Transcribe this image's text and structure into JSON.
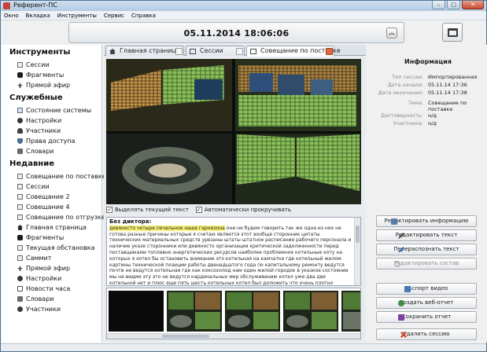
{
  "window": {
    "title": "Референт-ПС"
  },
  "menu": [
    "Окно",
    "Вкладка",
    "Инструменты",
    "Сервис",
    "Справка"
  ],
  "header": {
    "datetime": "05.11.2014  18:06:06",
    "collapse_icon": "double-chevron-up-icon",
    "screen_icon": "window-layout-icon"
  },
  "sidebar": {
    "tools_title": "Инструменты",
    "tools": [
      {
        "label": "Сессии",
        "icon": "session-icon"
      },
      {
        "label": "Фрагменты",
        "icon": "fragment-icon"
      },
      {
        "label": "Прямой эфир",
        "icon": "airplane-icon"
      }
    ],
    "service_title": "Служебные",
    "service": [
      {
        "label": "Состояние системы",
        "icon": "monitor-icon"
      },
      {
        "label": "Настройки",
        "icon": "gear-icon"
      },
      {
        "label": "Участники",
        "icon": "person-icon"
      },
      {
        "label": "Права доступа",
        "icon": "shield-icon"
      },
      {
        "label": "Словари",
        "icon": "book-icon"
      }
    ],
    "recent_title": "Недавние",
    "recent": [
      {
        "label": "Совещание по поставке",
        "icon": "session-icon"
      },
      {
        "label": "Сессии",
        "icon": "session-icon"
      },
      {
        "label": "Совещание 2",
        "icon": "session-icon"
      },
      {
        "label": "Совещание 4",
        "icon": "session-icon"
      },
      {
        "label": "Совещание по отгрузке",
        "icon": "session-icon"
      },
      {
        "label": "Главная страница",
        "icon": "home-icon"
      },
      {
        "label": "Фрагменты",
        "icon": "fragment-icon"
      },
      {
        "label": "Текущая обстановка",
        "icon": "session-icon"
      },
      {
        "label": "Саммит",
        "icon": "session-icon"
      },
      {
        "label": "Прямой эфир",
        "icon": "airplane-icon"
      },
      {
        "label": "Настройки",
        "icon": "gear-icon"
      },
      {
        "label": "Новости часа",
        "icon": "news-icon"
      },
      {
        "label": "Словари",
        "icon": "book-icon"
      },
      {
        "label": "Участники",
        "icon": "people-icon"
      }
    ]
  },
  "tabs": [
    {
      "label": "Главная страница",
      "icon": "home-icon",
      "active": false
    },
    {
      "label": "Сессии",
      "icon": "film-icon",
      "active": false
    },
    {
      "label": "Совещание по поставке",
      "icon": "session-icon",
      "active": true
    }
  ],
  "options": {
    "highlight_label": "Выделять текущий текст",
    "highlight_checked": true,
    "autoscroll_label": "Автоматически прокручивать",
    "autoscroll_checked": true
  },
  "transcript": {
    "speaker": "Без диктора:",
    "highlighted": "девяносто четыре печальное наше гарнизона",
    "text": " они не будем говорить так же одна из них не готова разные причины которые я считаю является этот вообще сторонник цитаты технических материальных средств урезаны штаты штатное расписание рабочего персонала и наличие указе сторонники или девяносто организации критической задолженности перед поставщиками топливно энергетических ресурсов наиболее проблемное котельные коту на которых я хотел бы остановить внимание это котельная на камчатке где котельный жилом картины технической позиции работы двенадцатого года по капитальному ремонту ведутся почти не ведутся котельная где как коксохолод нам один жилой городок в указкое состоянии мы не видим эту это не ведутся кардинальных мер обслуживанию котел уже два две котельной нет и плюс еще пять шесть котельных котел был доложить что очень плотно последние три недели работаем рука понимание есть но основной вопрос который ну необходимо решить это финансирование то есть нео принятий которые предлагаются или уже идут по реализации но вот тем не менее мы хотели бы в ближайшее время не зайти и не на чем готовить основные"
  },
  "info": {
    "title": "Информация",
    "rows": [
      {
        "label": "Тип сессии:",
        "value": "Импортированная"
      },
      {
        "label": "Дата начала:",
        "value": "05.11.14 17:36"
      },
      {
        "label": "Дата окончания:",
        "value": "05.11.14 17:38"
      },
      {
        "label": "Тема:",
        "value": "Совещание по поставке"
      },
      {
        "label": "Достоверность:",
        "value": "н/д"
      },
      {
        "label": "Участники:",
        "value": "н/д"
      }
    ]
  },
  "actions": [
    {
      "label": "Редактировать информацию",
      "icon": "edit-info-icon",
      "enabled": true
    },
    {
      "label": "Редактировать текст",
      "icon": "pencil-icon",
      "enabled": true
    },
    {
      "label": "Перераспознать текст",
      "icon": "recognize-icon",
      "enabled": true
    },
    {
      "label": "Редактировать состав",
      "icon": "refresh-icon",
      "enabled": false
    },
    {
      "label": "Экспорт видео",
      "icon": "film-export-icon",
      "enabled": true
    },
    {
      "label": "Создать веб-отчет",
      "icon": "web-report-icon",
      "enabled": true
    },
    {
      "label": "Сохранить отчет",
      "icon": "save-icon",
      "enabled": true
    },
    {
      "label": "Удалить сессию",
      "icon": "delete-icon",
      "enabled": true
    }
  ],
  "colors": {
    "window_frame": "#6f97b6",
    "highlight": "#f7ee70",
    "active_tab_close": "#e26a3e"
  }
}
